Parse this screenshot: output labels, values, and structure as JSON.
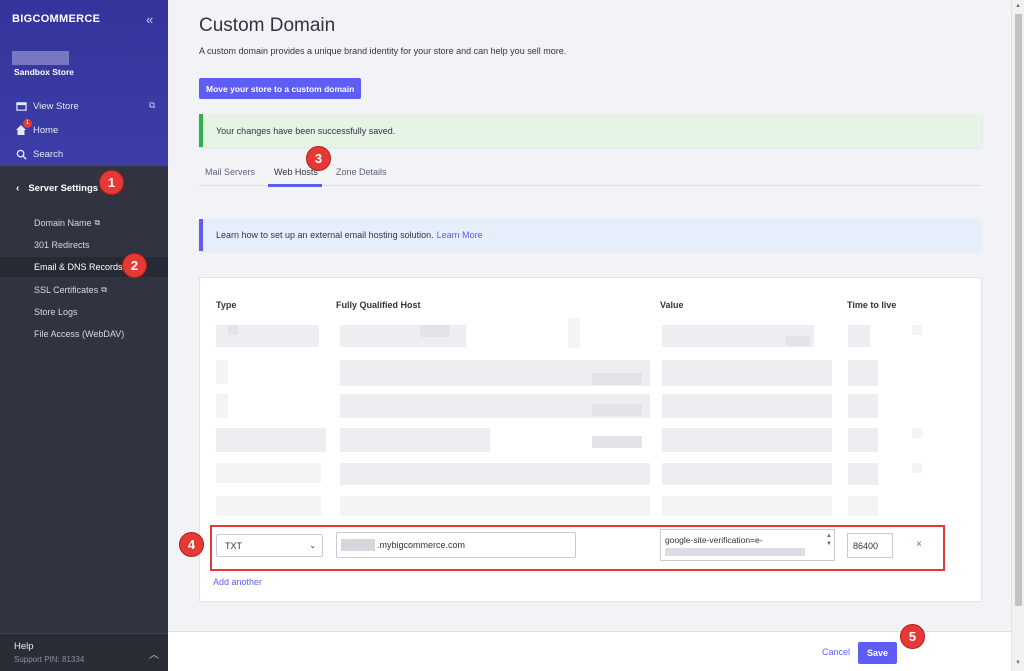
{
  "sidebar": {
    "brand": "BIGCOMMERCE",
    "store_name": "Sandbox Store",
    "links": [
      {
        "label": "View Store",
        "icon": "storefront-icon"
      },
      {
        "label": "Home",
        "icon": "home-icon",
        "badge": "1"
      },
      {
        "label": "Search",
        "icon": "search-icon"
      }
    ],
    "section_label": "Server Settings",
    "sub_items": [
      {
        "label": "Domain Name",
        "external": true
      },
      {
        "label": "301 Redirects"
      },
      {
        "label": "Email & DNS Records",
        "active": true
      },
      {
        "label": "SSL Certificates",
        "external": true
      },
      {
        "label": "Store Logs"
      },
      {
        "label": "File Access (WebDAV)"
      }
    ],
    "help_label": "Help",
    "support_pin": "Support PIN: 81334"
  },
  "page": {
    "title": "Custom Domain",
    "description": "A custom domain provides a unique brand identity for your store and can help you sell more.",
    "move_button": "Move your store to a custom domain",
    "success_message": "Your changes have been successfully saved.",
    "tabs": [
      "Mail Servers",
      "Web Hosts",
      "Zone Details"
    ],
    "active_tab": "Web Hosts",
    "info_text": "Learn how to set up an external email hosting solution.",
    "info_link": "Learn More"
  },
  "table": {
    "headers": [
      "Type",
      "Fully Qualified Host",
      "Value",
      "Time to live"
    ],
    "edit_row": {
      "type": "TXT",
      "host_suffix": ".mybigcommerce.com",
      "value": "google-site-verification=e-",
      "ttl": "86400",
      "remove": "×"
    },
    "add_another": "Add another"
  },
  "footer": {
    "cancel": "Cancel",
    "save": "Save"
  },
  "markers": [
    "1",
    "2",
    "3",
    "4",
    "5"
  ],
  "colors": {
    "sidebar_bg": "#313440",
    "brand_purple": "#5e5ef6",
    "success_green": "#2eb34b",
    "marker_red": "#e53935"
  }
}
